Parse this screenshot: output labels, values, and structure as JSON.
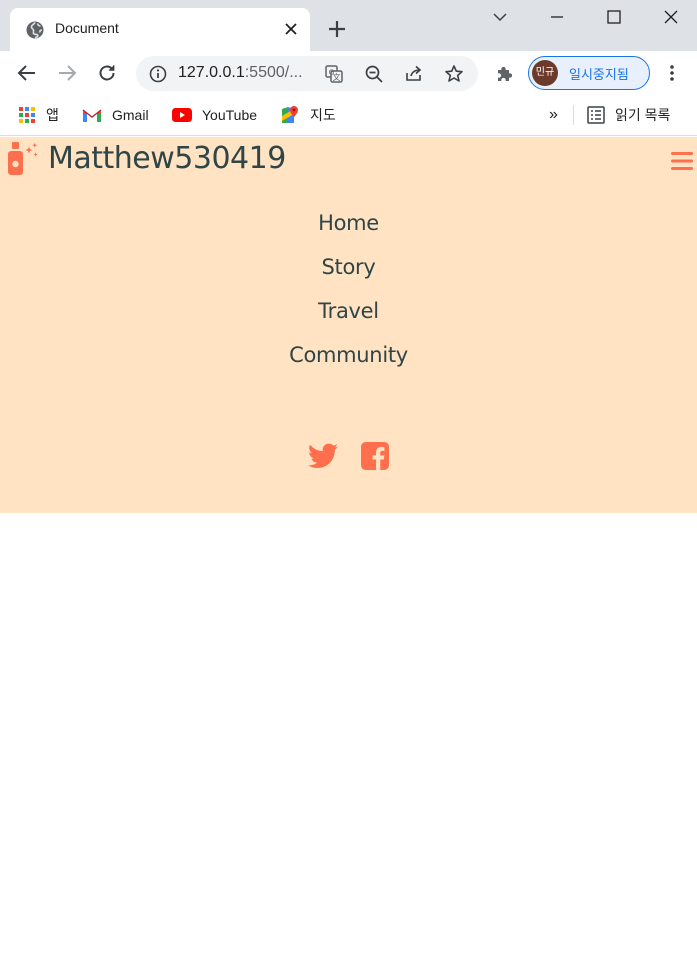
{
  "browser": {
    "tab_title": "Document",
    "url_host": "127.0.0.1",
    "url_rest": ":5500/...",
    "profile_initials": "민규",
    "profile_status": "일시중지됨",
    "bookmarks": [
      {
        "label": "앱",
        "icon": "apps-grid-icon"
      },
      {
        "label": "Gmail",
        "icon": "gmail-icon"
      },
      {
        "label": "YouTube",
        "icon": "youtube-icon"
      },
      {
        "label": "지도",
        "icon": "maps-icon"
      }
    ],
    "overflow_label": "»",
    "reading_list_label": "읽기 목록"
  },
  "site": {
    "brand": "Matthew530419",
    "nav": [
      "Home",
      "Story",
      "Travel",
      "Community"
    ],
    "accent_color": "#ff6f4d",
    "background_color": "#ffe3c2",
    "text_color": "#2f4548"
  }
}
